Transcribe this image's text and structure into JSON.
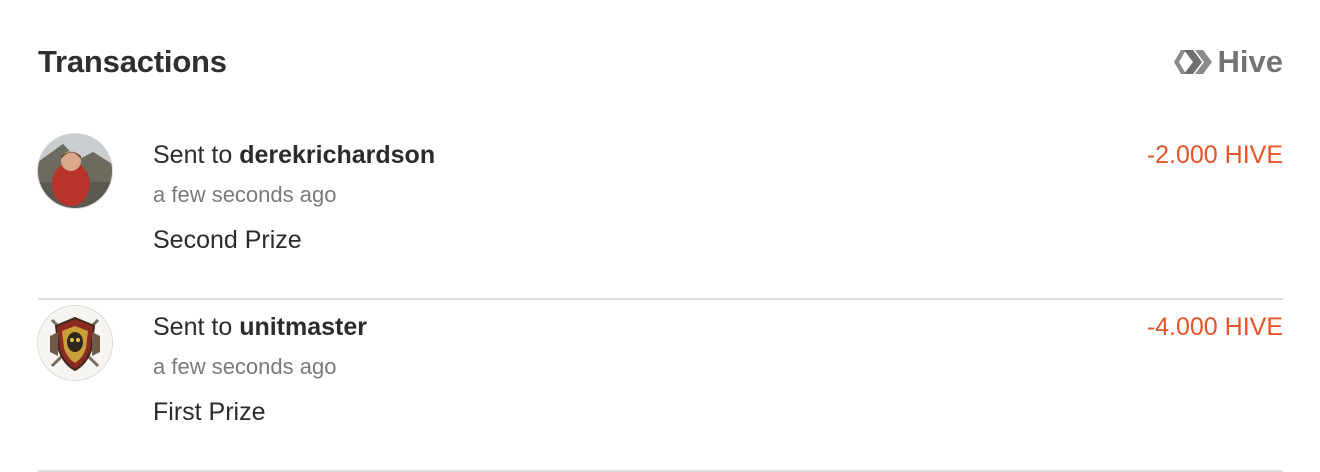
{
  "header": {
    "title": "Transactions",
    "brand_name": "Hive",
    "brand_icon": "hive-logo-icon"
  },
  "transactions": [
    {
      "prefix": "Sent to",
      "recipient": "derekrichardson",
      "time": "a few seconds ago",
      "memo": "Second Prize",
      "amount": "-2.000 HIVE",
      "avatar_icon": "user-avatar-photo"
    },
    {
      "prefix": "Sent to",
      "recipient": "unitmaster",
      "time": "a few seconds ago",
      "memo": "First Prize",
      "amount": "-4.000 HIVE",
      "avatar_icon": "user-avatar-shield-emblem"
    }
  ],
  "colors": {
    "negative_amount": "#e8542a",
    "muted_text": "#7a7a7a",
    "divider": "#dedede"
  }
}
